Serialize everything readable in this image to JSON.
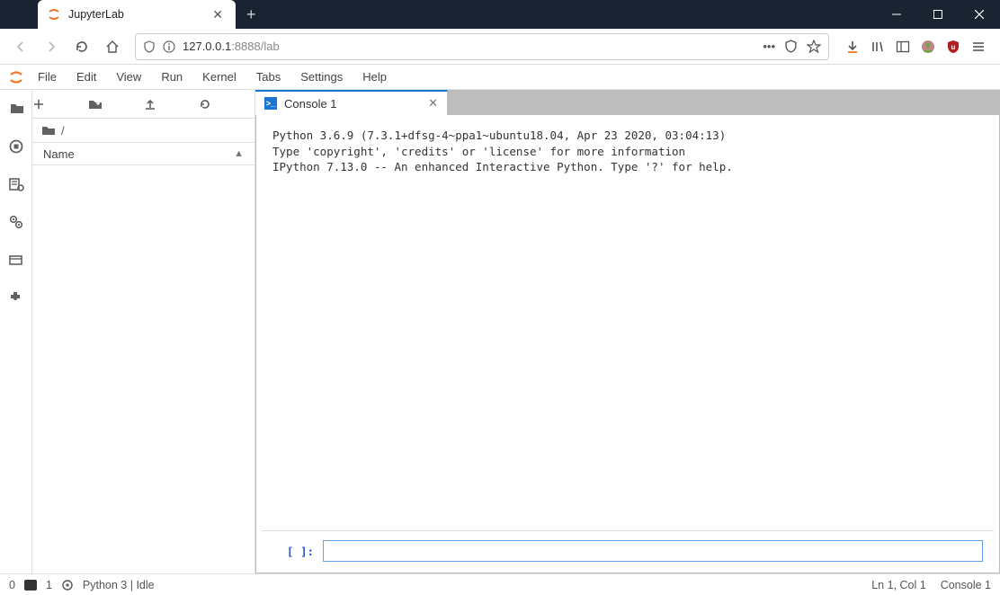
{
  "window": {
    "tab_title": "JupyterLab",
    "url_host": "127.0.0.1",
    "url_port": ":8888",
    "url_path": "/lab"
  },
  "menus": [
    "File",
    "Edit",
    "View",
    "Run",
    "Kernel",
    "Tabs",
    "Settings",
    "Help"
  ],
  "filebrowser": {
    "breadcrumb_root": "/",
    "name_header": "Name"
  },
  "console_tab": {
    "label": "Console 1"
  },
  "console": {
    "banner_line1": "Python 3.6.9 (7.3.1+dfsg-4~ppa1~ubuntu18.04, Apr 23 2020, 03:04:13)",
    "banner_line2": "Type 'copyright', 'credits' or 'license' for more information",
    "banner_line3": "IPython 7.13.0 -- An enhanced Interactive Python. Type '?' for help.",
    "prompt": "[ ]:"
  },
  "status": {
    "terminals": "0",
    "kernels": "1",
    "kernel": "Python 3 | Idle",
    "cursor": "Ln 1, Col 1",
    "mode": "Console 1"
  }
}
